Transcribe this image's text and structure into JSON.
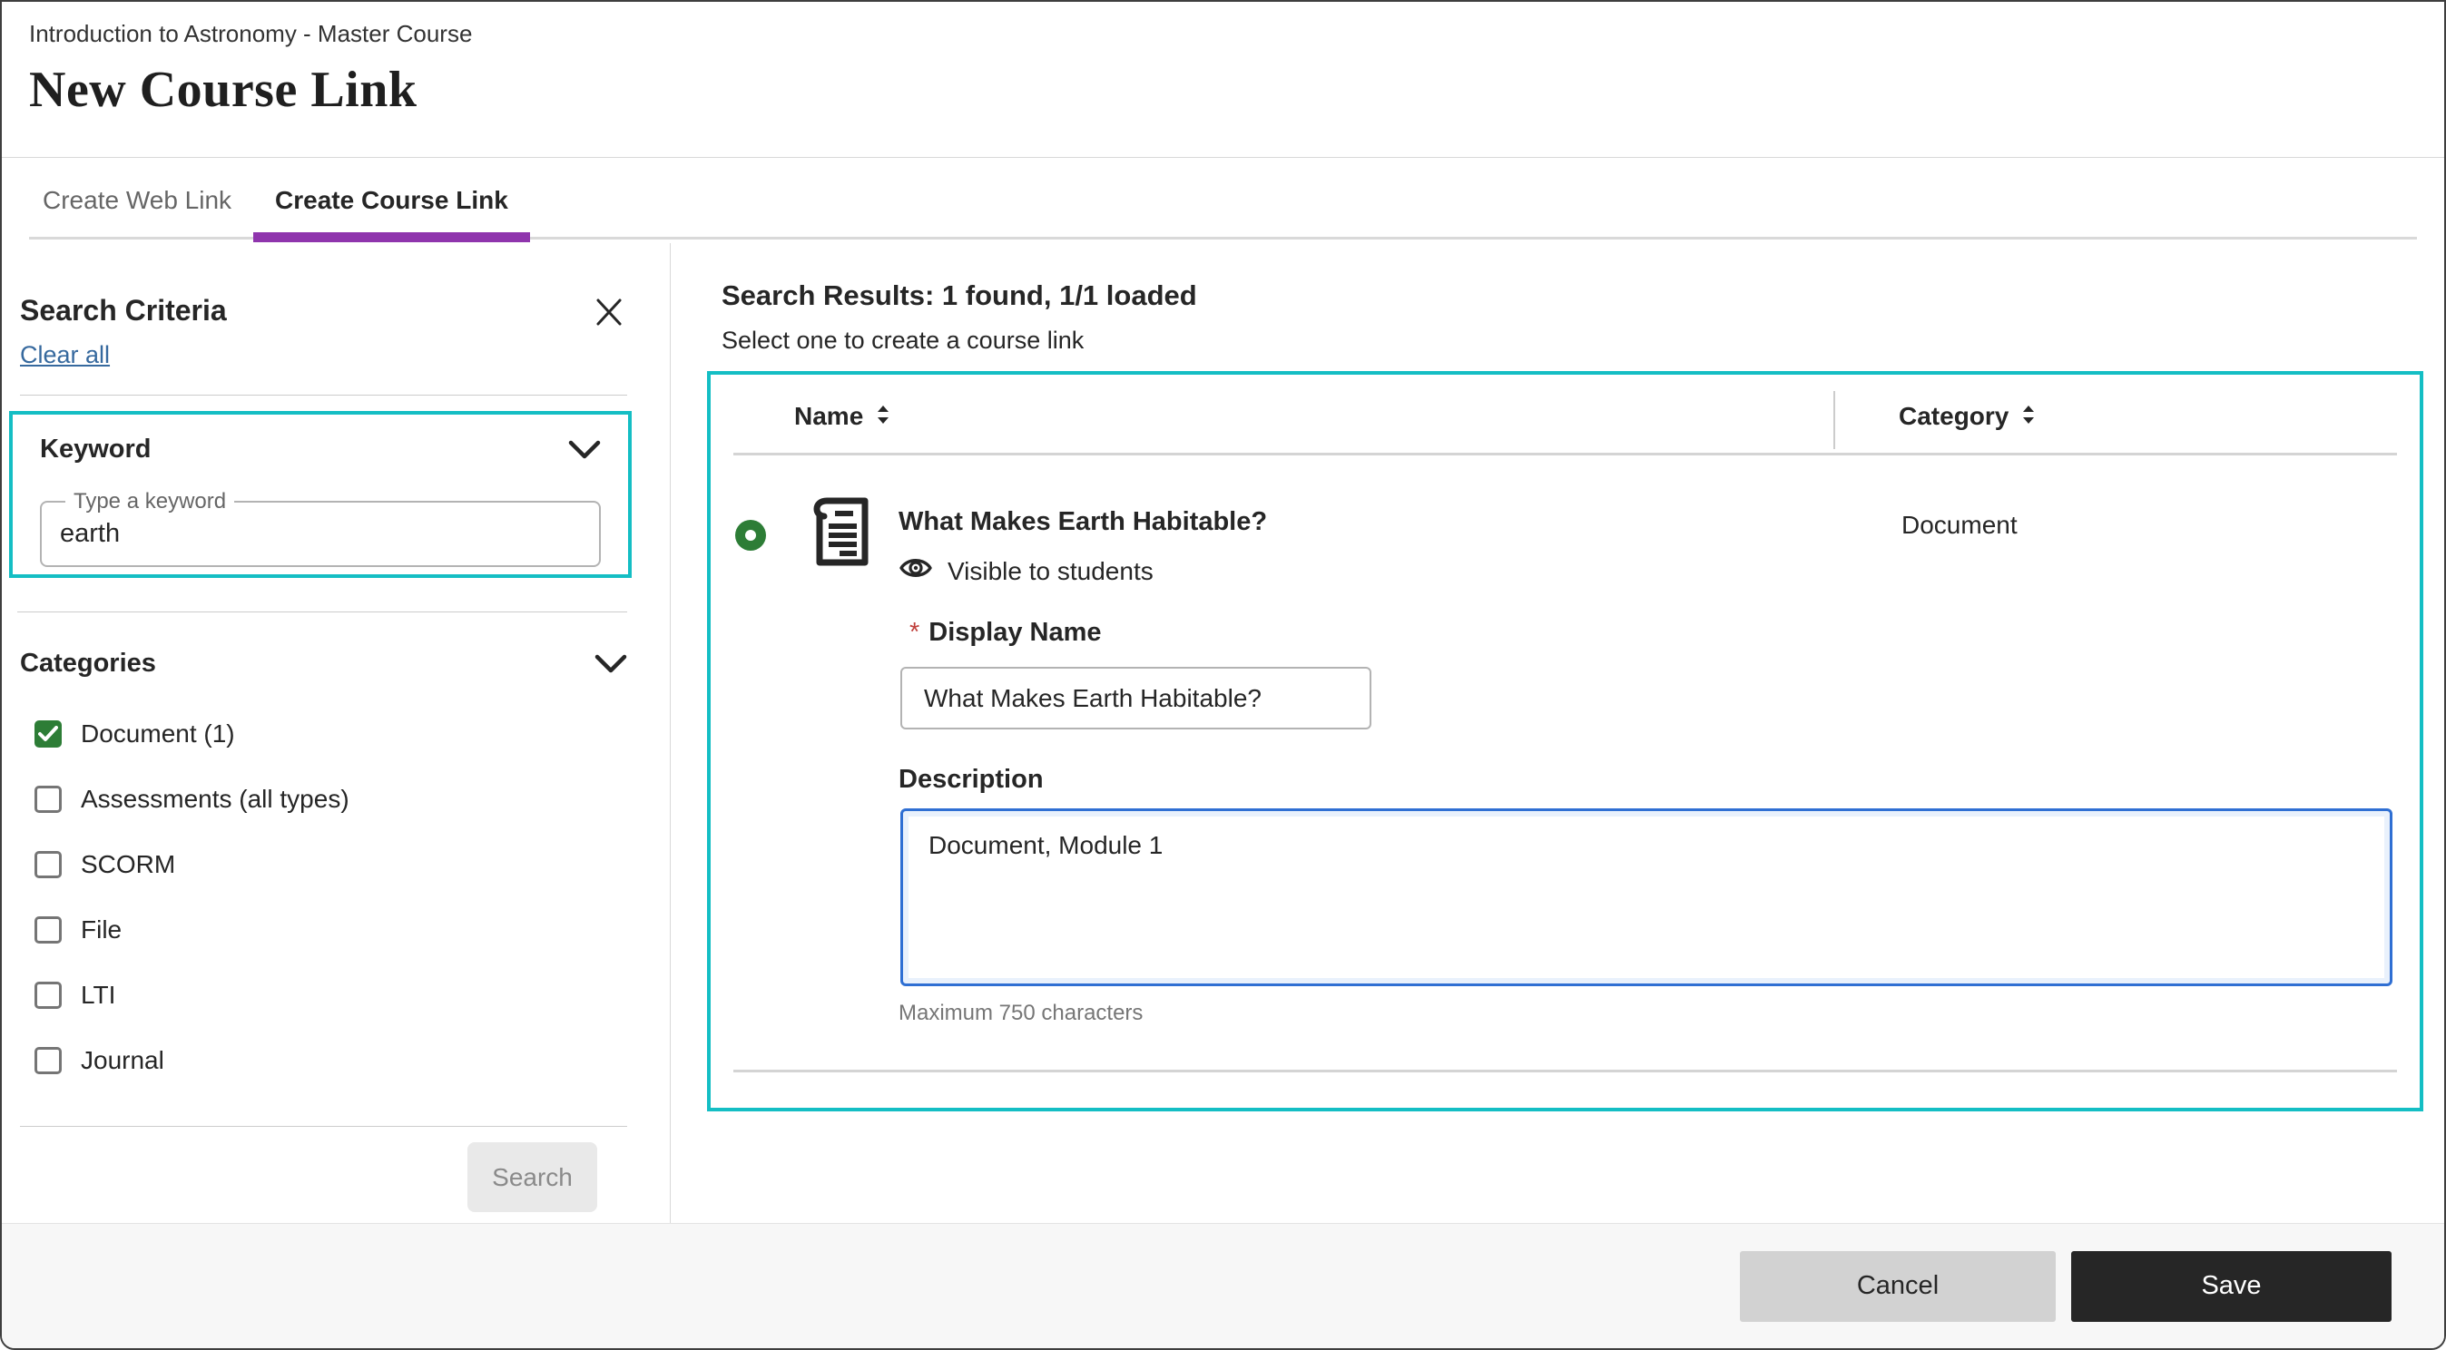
{
  "header": {
    "breadcrumb": "Introduction to Astronomy - Master Course",
    "title": "New Course Link"
  },
  "tabs": [
    {
      "label": "Create Web Link",
      "active": false
    },
    {
      "label": "Create Course Link",
      "active": true
    }
  ],
  "sidebar": {
    "heading": "Search Criteria",
    "clear_all": "Clear all",
    "close_icon": "close-x",
    "keyword_section": {
      "heading": "Keyword",
      "collapse_icon": "chevron-down",
      "input_label": "Type a keyword",
      "input_value": "earth"
    },
    "categories_section": {
      "heading": "Categories",
      "collapse_icon": "chevron-down",
      "options": [
        {
          "label": "Document (1)",
          "checked": true
        },
        {
          "label": "Assessments (all types)",
          "checked": false
        },
        {
          "label": "SCORM",
          "checked": false
        },
        {
          "label": "File",
          "checked": false
        },
        {
          "label": "LTI",
          "checked": false
        },
        {
          "label": "Journal",
          "checked": false
        }
      ]
    },
    "search_button": "Search"
  },
  "results": {
    "heading": "Search Results: 1 found, 1/1 loaded",
    "subtitle": "Select one to create a course link",
    "table": {
      "columns": [
        {
          "label": "Name",
          "sort_icon": "sort-arrows"
        },
        {
          "label": "Category",
          "sort_icon": "sort-arrows"
        }
      ]
    },
    "row": {
      "selected": true,
      "icon": "document",
      "name": "What Makes Earth Habitable?",
      "visibility_icon": "eye",
      "visibility": "Visible to students",
      "category": "Document"
    },
    "form": {
      "required_marker": "*",
      "display_name_label": "Display Name",
      "display_name_value": "What Makes Earth Habitable?",
      "description_label": "Description",
      "description_value": "Document, Module 1",
      "description_help": "Maximum 750 characters"
    }
  },
  "footer": {
    "cancel": "Cancel",
    "save": "Save"
  },
  "colors": {
    "teal": "#14bec4",
    "purple": "#8f35ad",
    "green": "#2d7d36",
    "link": "#36699e",
    "focus": "#2f6fd3",
    "halo": "#e9f1fc",
    "red": "#c0403c"
  }
}
